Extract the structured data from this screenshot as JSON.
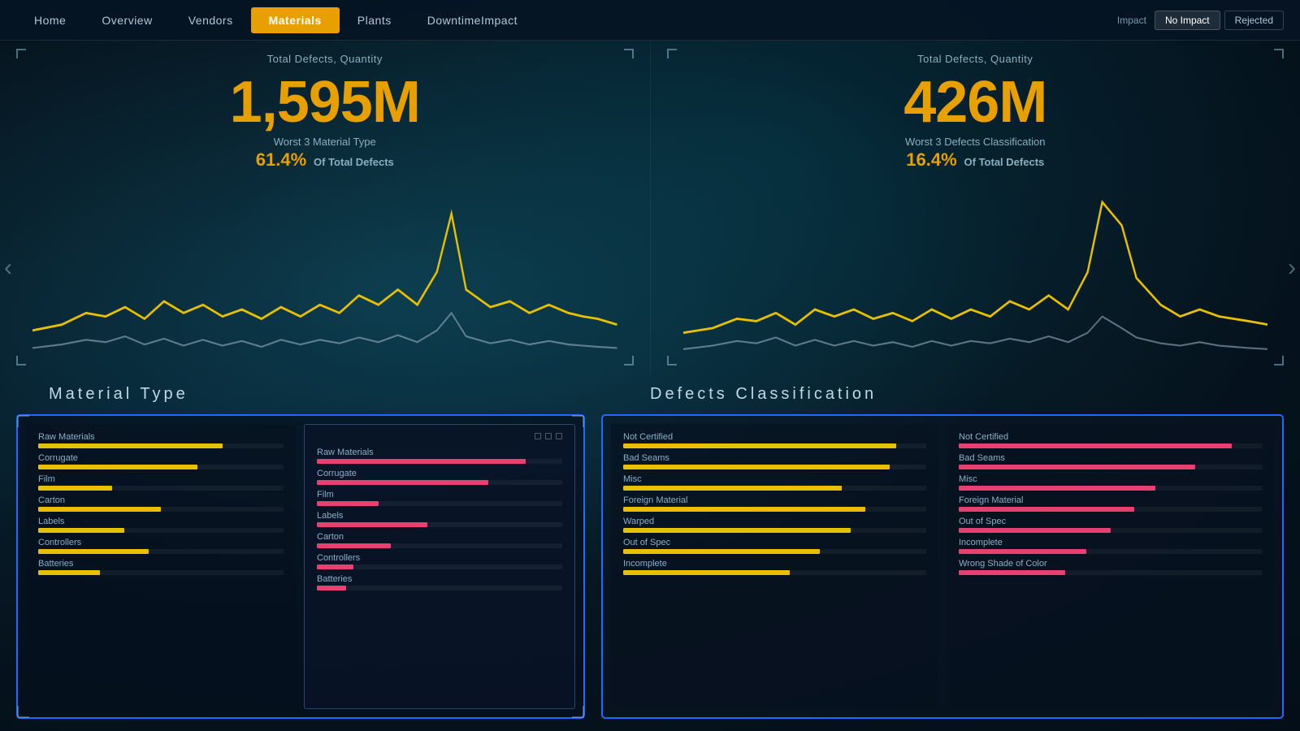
{
  "nav": {
    "items": [
      {
        "id": "home",
        "label": "Home",
        "active": false
      },
      {
        "id": "overview",
        "label": "Overview",
        "active": false
      },
      {
        "id": "vendors",
        "label": "Vendors",
        "active": false
      },
      {
        "id": "materials",
        "label": "Materials",
        "active": true
      },
      {
        "id": "plants",
        "label": "Plants",
        "active": false
      },
      {
        "id": "downtime",
        "label": "DowntimeImpact",
        "active": false
      }
    ],
    "filters": {
      "label": "Impact",
      "buttons": [
        {
          "id": "no-impact",
          "label": "No Impact",
          "active": true
        },
        {
          "id": "rejected",
          "label": "Rejected",
          "active": false
        }
      ]
    }
  },
  "left_chart": {
    "title": "Total Defects, Quantity",
    "value": "1,595M",
    "subtitle": "Worst 3 Material Type",
    "percent": "61.4%",
    "percent_label": "Of Total Defects"
  },
  "right_chart": {
    "title": "Total Defects, Quantity",
    "value": "426M",
    "subtitle": "Worst 3 Defects Classification",
    "percent": "16.4%",
    "percent_label": "Of Total Defects"
  },
  "section_labels": {
    "left": "Material  Type",
    "right": "Defects  Classification"
  },
  "material_panel_left": {
    "items": [
      {
        "label": "Raw Materials",
        "yellow": 75,
        "pink": 0
      },
      {
        "label": "Corrugate",
        "yellow": 65,
        "pink": 0
      },
      {
        "label": "Film",
        "yellow": 30,
        "pink": 0
      },
      {
        "label": "Carton",
        "yellow": 50,
        "pink": 0
      },
      {
        "label": "Labels",
        "yellow": 35,
        "pink": 0
      },
      {
        "label": "Controllers",
        "yellow": 45,
        "pink": 0
      },
      {
        "label": "Batteries",
        "yellow": 25,
        "pink": 0
      }
    ]
  },
  "material_panel_right": {
    "items": [
      {
        "label": "Raw Materials",
        "yellow": 0,
        "pink": 85
      },
      {
        "label": "Corrugate",
        "yellow": 0,
        "pink": 70
      },
      {
        "label": "Film",
        "yellow": 0,
        "pink": 25
      },
      {
        "label": "Labels",
        "yellow": 0,
        "pink": 45
      },
      {
        "label": "Carton",
        "yellow": 0,
        "pink": 30
      },
      {
        "label": "Controllers",
        "yellow": 0,
        "pink": 15
      },
      {
        "label": "Batteries",
        "yellow": 0,
        "pink": 12
      }
    ]
  },
  "defects_panel_left": {
    "items": [
      {
        "label": "Not Certified",
        "yellow": 90,
        "pink": 0
      },
      {
        "label": "Bad Seams",
        "yellow": 88,
        "pink": 0
      },
      {
        "label": "Misc",
        "yellow": 72,
        "pink": 0
      },
      {
        "label": "Foreign Material",
        "yellow": 80,
        "pink": 0
      },
      {
        "label": "Warped",
        "yellow": 75,
        "pink": 0
      },
      {
        "label": "Out of Spec",
        "yellow": 65,
        "pink": 0
      },
      {
        "label": "Incomplete",
        "yellow": 55,
        "pink": 0
      }
    ]
  },
  "defects_panel_right": {
    "items": [
      {
        "label": "Not Certified",
        "yellow": 0,
        "pink": 90
      },
      {
        "label": "Bad Seams",
        "yellow": 0,
        "pink": 78
      },
      {
        "label": "Misc",
        "yellow": 0,
        "pink": 65
      },
      {
        "label": "Foreign Material",
        "yellow": 0,
        "pink": 58
      },
      {
        "label": "Out of Spec",
        "yellow": 0,
        "pink": 50
      },
      {
        "label": "Incomplete",
        "yellow": 0,
        "pink": 42
      },
      {
        "label": "Wrong Shade of Color",
        "yellow": 0,
        "pink": 35
      }
    ]
  },
  "colors": {
    "accent_yellow": "#e8a000",
    "accent_pink": "#e84070",
    "nav_active": "#e8a000",
    "border_blue": "#1e6aff",
    "text_muted": "#8ab0c8"
  }
}
